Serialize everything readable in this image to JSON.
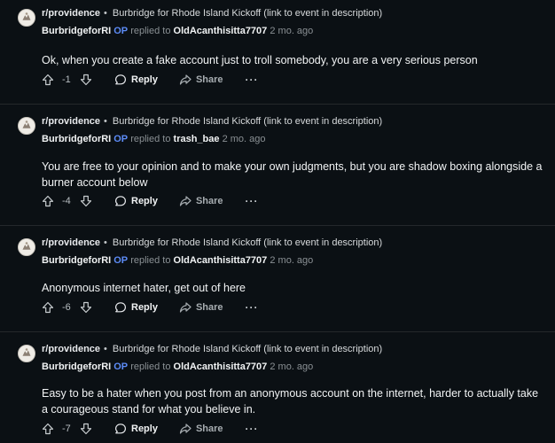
{
  "comments": [
    {
      "subreddit": "r/providence",
      "post_title": "Burbridge for Rhode Island Kickoff (link to event in description)",
      "author": "BurbridgeforRI",
      "op_badge": "OP",
      "replied_to_text": "replied to",
      "replied_to": "OldAcanthisitta7707",
      "time": "2 mo. ago",
      "body": "Ok, when you create a fake account just to troll somebody, you are a very serious person",
      "score": "-1",
      "reply_label": "Reply",
      "share_label": "Share",
      "more_label": "···"
    },
    {
      "subreddit": "r/providence",
      "post_title": "Burbridge for Rhode Island Kickoff (link to event in description)",
      "author": "BurbridgeforRI",
      "op_badge": "OP",
      "replied_to_text": "replied to",
      "replied_to": "trash_bae",
      "time": "2 mo. ago",
      "body": "You are free to your opinion and to make your own judgments, but you are shadow boxing alongside a burner account below",
      "score": "-4",
      "reply_label": "Reply",
      "share_label": "Share",
      "more_label": "···"
    },
    {
      "subreddit": "r/providence",
      "post_title": "Burbridge for Rhode Island Kickoff (link to event in description)",
      "author": "BurbridgeforRI",
      "op_badge": "OP",
      "replied_to_text": "replied to",
      "replied_to": "OldAcanthisitta7707",
      "time": "2 mo. ago",
      "body": "Anonymous internet hater, get out of here",
      "score": "-6",
      "reply_label": "Reply",
      "share_label": "Share",
      "more_label": "···"
    },
    {
      "subreddit": "r/providence",
      "post_title": "Burbridge for Rhode Island Kickoff (link to event in description)",
      "author": "BurbridgeforRI",
      "op_badge": "OP",
      "replied_to_text": "replied to",
      "replied_to": "OldAcanthisitta7707",
      "time": "2 mo. ago",
      "body": "Easy to be a hater when you post from an anonymous account on the internet, harder to actually take a courageous stand for what you believe in.",
      "score": "-7",
      "reply_label": "Reply",
      "share_label": "Share",
      "more_label": "···"
    }
  ],
  "colors": {
    "background": "#0b1014",
    "op_badge": "#5d8cf7",
    "divider": "#24282b"
  },
  "icons": {
    "avatar": "subreddit-avatar",
    "upvote": "upvote-arrow-icon",
    "downvote": "downvote-arrow-icon",
    "reply": "comment-bubble-icon",
    "share": "share-arrow-icon",
    "more": "ellipsis-icon"
  }
}
